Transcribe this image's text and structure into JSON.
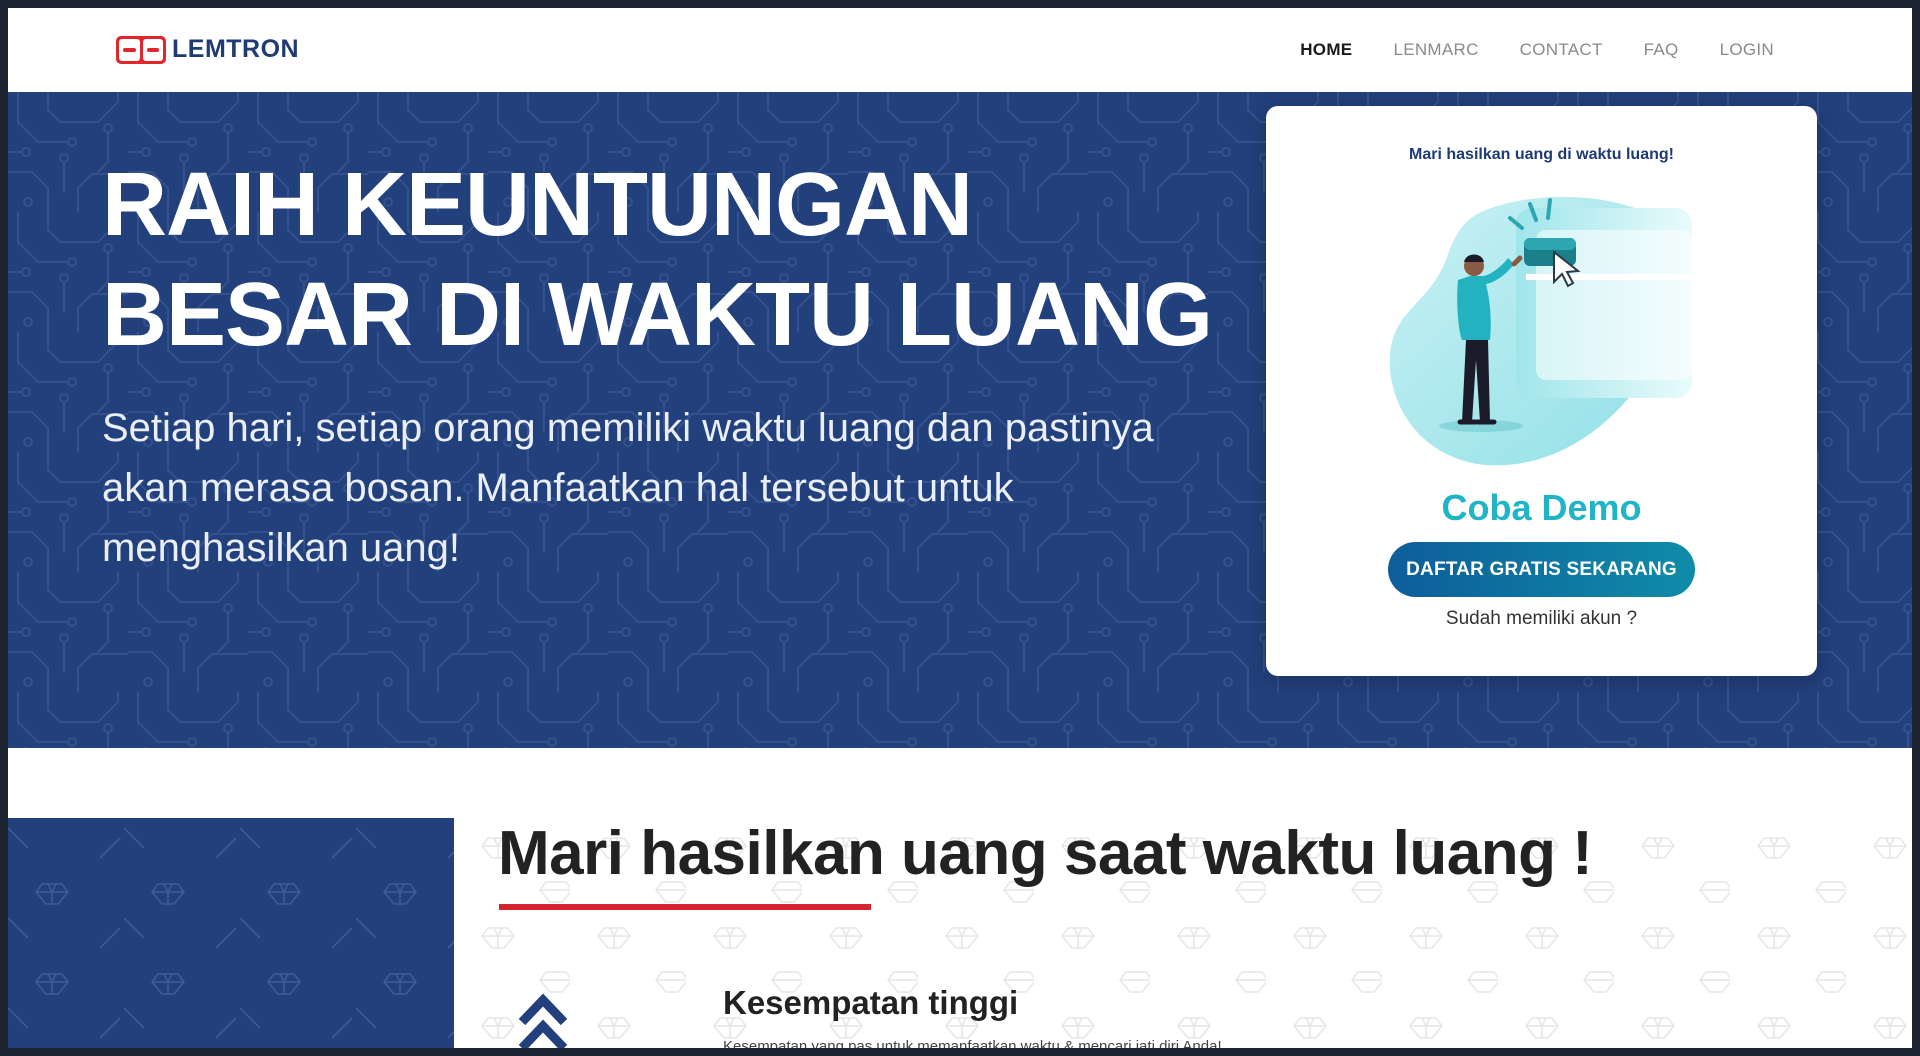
{
  "brand": {
    "name": "LEMTRON"
  },
  "nav": {
    "items": [
      {
        "label": "HOME",
        "active": true
      },
      {
        "label": "LENMARC",
        "active": false
      },
      {
        "label": "CONTACT",
        "active": false
      },
      {
        "label": "FAQ",
        "active": false
      },
      {
        "label": "LOGIN",
        "active": false
      }
    ]
  },
  "hero": {
    "title_line1": "RAIH KEUNTUNGAN",
    "title_line2": "BESAR DI WAKTU LUANG",
    "description": "Setiap hari, setiap orang memiliki waktu luang dan pastinya akan merasa bosan. Manfaatkan hal tersebut untuk menghasilkan uang!"
  },
  "signup_card": {
    "tagline": "Mari hasilkan uang di waktu luang!",
    "illustration_icon": "person-clicking-button-illustration",
    "demo_label": "Coba Demo",
    "cta_label": "DAFTAR GRATIS SEKARANG",
    "login_prompt": "Sudah memiliki akun ?"
  },
  "section_benefits": {
    "title": "Mari hasilkan uang saat waktu luang !",
    "features": [
      {
        "icon": "double-chevron-up-icon",
        "title": "Kesempatan tinggi",
        "description": "Kesempatan yang pas untuk memanfaatkan waktu & mencari jati diri Anda!"
      }
    ]
  },
  "colors": {
    "brand_red": "#e1262c",
    "brand_navy": "#22407c",
    "accent_teal": "#1fb4c6",
    "underline_red": "#d5242f"
  }
}
